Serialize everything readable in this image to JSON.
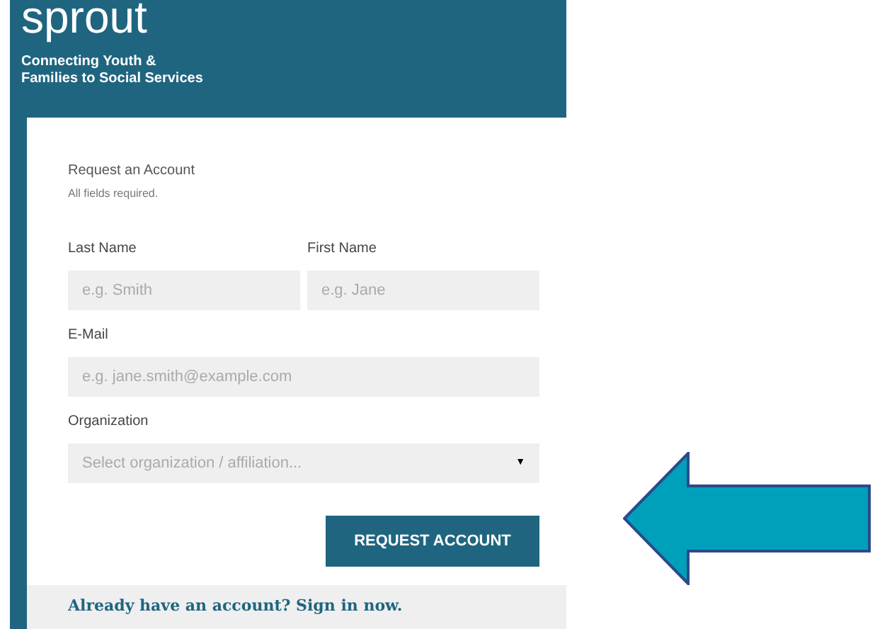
{
  "header": {
    "logo": "sprout",
    "tagline_lines": [
      "Connecting Youth &",
      "Families to Social Services"
    ]
  },
  "form": {
    "title": "Request an Account",
    "note": "All fields required.",
    "name_fields": [
      {
        "label": "Last Name",
        "placeholder": "e.g. Smith"
      },
      {
        "label": "First Name",
        "placeholder": "e.g. Jane"
      }
    ],
    "email": {
      "label": "E-Mail",
      "placeholder": "e.g. jane.smith@example.com"
    },
    "organization": {
      "label": "Organization",
      "placeholder": "Select organization / affiliation...",
      "caret": "▼"
    },
    "submit": "REQUEST ACCOUNT"
  },
  "footer": {
    "link": "Already have an account? Sign in now."
  }
}
